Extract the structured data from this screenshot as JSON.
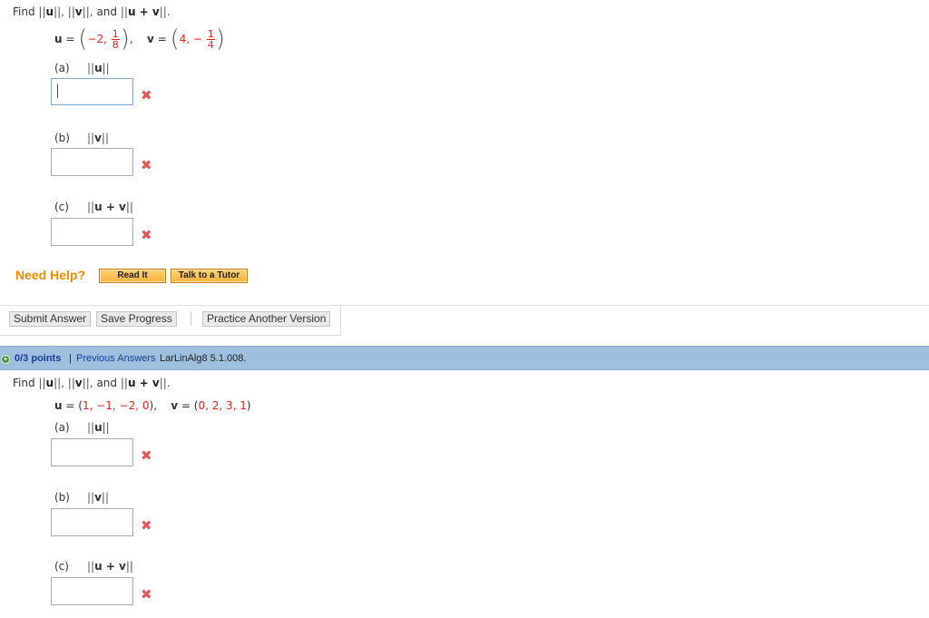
{
  "question1": {
    "prompt": {
      "find": "Find",
      "n1_open": "||",
      "n1_var": "u",
      "n1_close": "||,",
      "n2_open": "||",
      "n2_var": "v",
      "n2_close": "||,",
      "and": "and",
      "n3_open": "||",
      "n3_var": "u + v",
      "n3_close": "||."
    },
    "u": {
      "label": "u",
      "eq": "=",
      "first": "−2,",
      "frac_num": "1",
      "frac_den": "8",
      "close": "),"
    },
    "v": {
      "label": "v",
      "eq": "=",
      "first": "4, −",
      "frac_num": "1",
      "frac_den": "4",
      "close": ")"
    },
    "parts": [
      {
        "tag": "(a)",
        "open": "||",
        "expr": "u",
        "close": "||",
        "value": ""
      },
      {
        "tag": "(b)",
        "open": "||",
        "expr": "v",
        "close": "||",
        "value": ""
      },
      {
        "tag": "(c)",
        "open": "||",
        "expr": "u + v",
        "close": "||",
        "value": ""
      }
    ],
    "incorrect_icon": "✖"
  },
  "help": {
    "label": "Need Help?",
    "read_it": "Read It",
    "talk_tutor": "Talk to a Tutor"
  },
  "actions": {
    "submit": "Submit Answer",
    "save": "Save Progress",
    "practice": "Practice Another Version"
  },
  "question2": {
    "header": {
      "points": "0/3 points",
      "divider": "|",
      "previous": "Previous Answers",
      "source": "LarLinAlg8 5.1.008."
    },
    "prompt": {
      "find": "Find",
      "n1_open": "||",
      "n1_var": "u",
      "n1_close": "||,",
      "n2_open": "||",
      "n2_var": "v",
      "n2_close": "||,",
      "and": "and",
      "n3_open": "||",
      "n3_var": "u + v",
      "n3_close": "||."
    },
    "u": {
      "label": "u",
      "eq": "= (",
      "values": "1, −1, −2, 0",
      "close": "),"
    },
    "v": {
      "label": "v",
      "eq": "= (",
      "values": "0, 2, 3, 1",
      "close": ")"
    },
    "parts": [
      {
        "tag": "(a)",
        "open": "||",
        "expr": "u",
        "close": "||",
        "value": ""
      },
      {
        "tag": "(b)",
        "open": "||",
        "expr": "v",
        "close": "||",
        "value": ""
      },
      {
        "tag": "(c)",
        "open": "||",
        "expr": "u + v",
        "close": "||",
        "value": ""
      }
    ],
    "incorrect_icon": "✖"
  }
}
